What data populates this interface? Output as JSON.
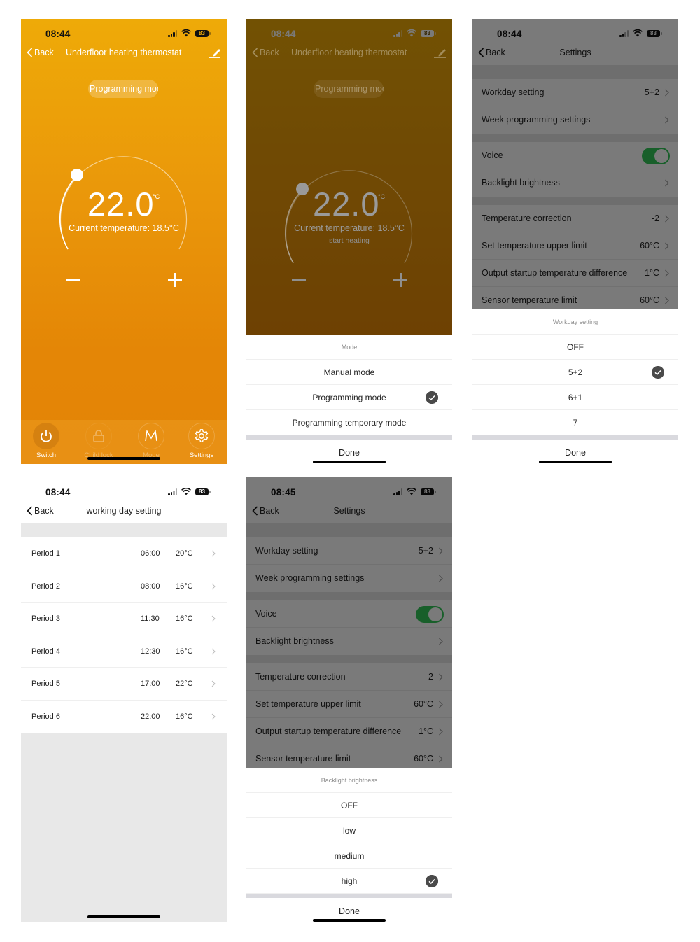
{
  "colors": {
    "thermostat_gradient_top": "#eeaa08",
    "thermostat_gradient_bottom": "#e38406",
    "toggle_on": "#34c759",
    "check_badge": "#4a4a4a",
    "overlay": "rgba(0,0,0,0.52)"
  },
  "screens": [
    {
      "id": "thermostat-main",
      "status": {
        "time": "08:44",
        "battery": "83"
      },
      "nav": {
        "back_label": "Back",
        "title": "Underfloor heating thermostat",
        "edit_icon": "pencil-icon"
      },
      "mode_pill": "Programming moc",
      "set_temperature": "22.0",
      "unit": "°C",
      "current_temperature": "Current temperature: 18.5°C",
      "tabs": [
        {
          "label": "Switch",
          "icon": "power-icon"
        },
        {
          "label": "Child lock",
          "icon": "lock-icon"
        },
        {
          "label": "Mode",
          "icon": "mode-m-icon"
        },
        {
          "label": "Settings",
          "icon": "gear-icon"
        }
      ]
    },
    {
      "id": "mode-sheet",
      "status": {
        "time": "08:44",
        "battery": "83"
      },
      "nav": {
        "back_label": "Back",
        "title": "Underfloor heating thermostat"
      },
      "mode_pill": "Programming moc",
      "set_temperature": "22.0",
      "unit": "°C",
      "current_temperature": "Current temperature: 18.5°C",
      "heating_status": "start heating",
      "sheet": {
        "title": "Mode",
        "options": [
          {
            "label": "Manual mode",
            "selected": false
          },
          {
            "label": "Programming mode",
            "selected": true
          },
          {
            "label": "Programming temporary mode",
            "selected": false
          }
        ],
        "done_label": "Done"
      }
    },
    {
      "id": "settings-workday-sheet",
      "status": {
        "time": "08:44",
        "battery": "83"
      },
      "nav": {
        "back_label": "Back",
        "title": "Settings"
      },
      "sheet": {
        "title": "Workday setting",
        "options": [
          {
            "label": "OFF",
            "selected": false
          },
          {
            "label": "5+2",
            "selected": true
          },
          {
            "label": "6+1",
            "selected": false
          },
          {
            "label": "7",
            "selected": false
          }
        ],
        "done_label": "Done"
      }
    },
    {
      "id": "working-day-setting",
      "status": {
        "time": "08:44",
        "battery": "83"
      },
      "nav": {
        "back_label": "Back",
        "title": "working day setting"
      },
      "periods": [
        {
          "name": "Period 1",
          "time": "06:00",
          "temp": "20°C"
        },
        {
          "name": "Period 2",
          "time": "08:00",
          "temp": "16°C"
        },
        {
          "name": "Period 3",
          "time": "11:30",
          "temp": "16°C"
        },
        {
          "name": "Period 4",
          "time": "12:30",
          "temp": "16°C"
        },
        {
          "name": "Period 5",
          "time": "17:00",
          "temp": "22°C"
        },
        {
          "name": "Period 6",
          "time": "22:00",
          "temp": "16°C"
        }
      ]
    },
    {
      "id": "settings-backlight-sheet",
      "status": {
        "time": "08:45",
        "battery": "83"
      },
      "nav": {
        "back_label": "Back",
        "title": "Settings"
      },
      "sheet": {
        "title": "Backlight brightness",
        "options": [
          {
            "label": "OFF",
            "selected": false
          },
          {
            "label": "low",
            "selected": false
          },
          {
            "label": "medium",
            "selected": false
          },
          {
            "label": "high",
            "selected": true
          }
        ],
        "done_label": "Done"
      }
    }
  ],
  "settings_list": {
    "group1": [
      {
        "label": "Workday setting",
        "value": "5+2"
      },
      {
        "label": "Week programming settings",
        "value": ""
      }
    ],
    "group2": [
      {
        "label": "Voice",
        "toggle": true
      },
      {
        "label": "Backlight brightness",
        "value": ""
      }
    ],
    "group3": [
      {
        "label": "Temperature correction",
        "value": "-2"
      },
      {
        "label": "Set temperature upper limit",
        "value": "60°C"
      },
      {
        "label": "Output startup temperature difference",
        "value": "1°C"
      },
      {
        "label": "Sensor temperature limit",
        "value": "60°C"
      }
    ]
  }
}
